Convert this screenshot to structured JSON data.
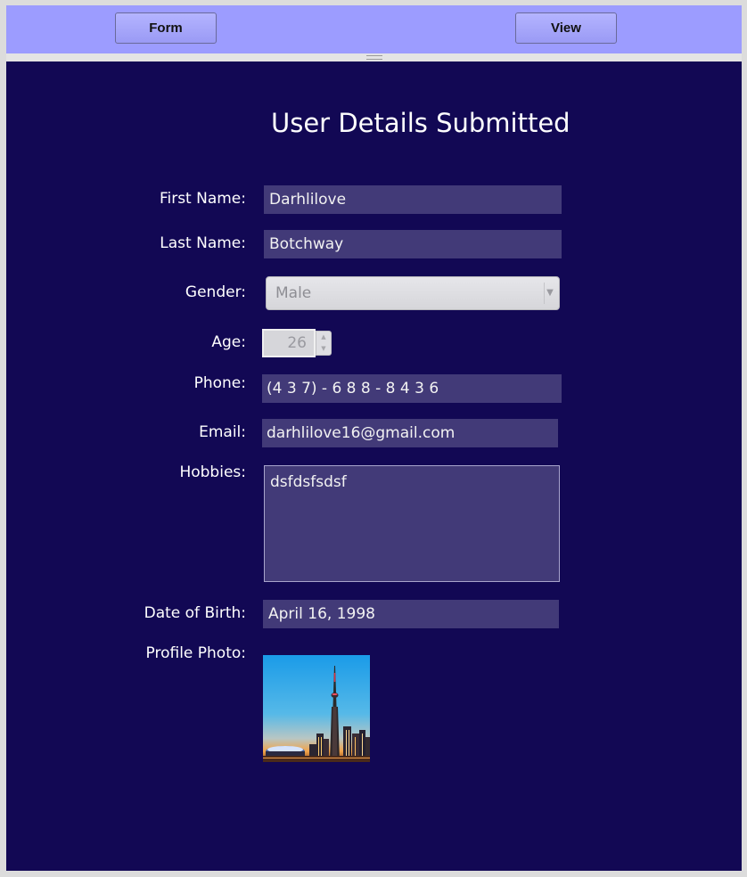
{
  "toolbar": {
    "form_label": "Form",
    "view_label": "View"
  },
  "panel": {
    "title": "User Details Submitted",
    "labels": {
      "first_name": "First Name:",
      "last_name": "Last Name:",
      "gender": "Gender:",
      "age": "Age:",
      "phone": "Phone:",
      "email": "Email:",
      "hobbies": "Hobbies:",
      "dob": "Date of Birth:",
      "photo": "Profile Photo:"
    },
    "values": {
      "first_name": "Darhlilove",
      "last_name": "Botchway",
      "gender": "Male",
      "age": "26",
      "phone": "(4 3 7) - 6 8 8 - 8 4 3 6",
      "email": "darhlilove16@gmail.com",
      "hobbies": "dsfdsfsdsf",
      "dob": "April 16, 1998"
    }
  },
  "colors": {
    "toolbar_bg": "#9c9cff",
    "panel_bg": "#120854",
    "field_bg": "#423a78"
  },
  "icons": {
    "dropdown": "chevron-down-icon",
    "spinner_up": "chevron-up-icon",
    "spinner_down": "chevron-down-icon",
    "splitter": "drag-handle-icon"
  }
}
